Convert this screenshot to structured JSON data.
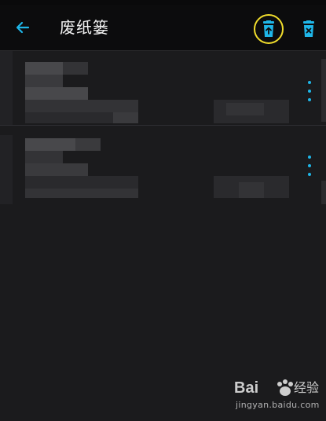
{
  "appbar": {
    "title": "废纸篓",
    "back_icon": "arrow-left-icon",
    "restore_icon": "trash-restore-icon",
    "delete_icon": "trash-delete-icon"
  },
  "notes": [
    {
      "more_icon": "more-vertical-icon"
    },
    {
      "more_icon": "more-vertical-icon"
    }
  ],
  "colors": {
    "accent": "#1fb6e8",
    "highlight": "#f1dd2c",
    "background": "#1b1b1d",
    "appbar": "#0c0c0d"
  },
  "watermark": {
    "brand_left": "Bai",
    "brand_right": "经验",
    "url": "jingyan.baidu.com"
  }
}
